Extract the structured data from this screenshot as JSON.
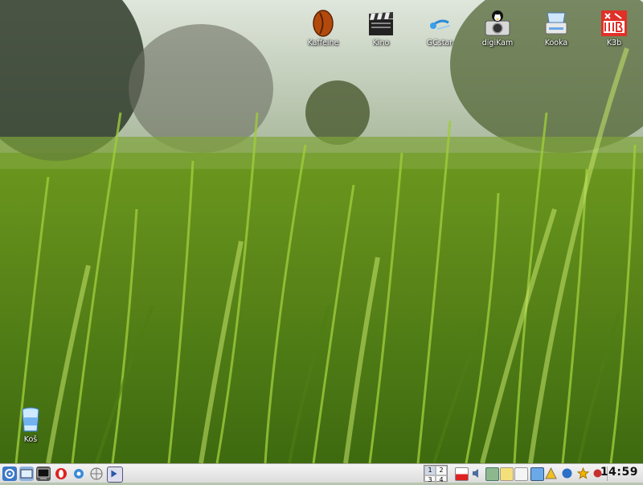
{
  "desktop": {
    "top_icons": [
      {
        "label": "Kaffeine",
        "icon": "kaffeine-coffee-bean-icon"
      },
      {
        "label": "Kino",
        "icon": "film-clapper-icon"
      },
      {
        "label": "GCstar",
        "icon": "gcstar-icon"
      },
      {
        "label": "digiKam",
        "icon": "digikam-camera-icon"
      },
      {
        "label": "Kooka",
        "icon": "scanner-icon"
      },
      {
        "label": "K3b",
        "icon": "k3b-icon"
      }
    ],
    "trash": {
      "label": "Koš",
      "icon": "trash-bin-icon"
    }
  },
  "taskbar": {
    "pager": [
      "1",
      "2",
      "3",
      "4"
    ],
    "clock": "14:59"
  }
}
